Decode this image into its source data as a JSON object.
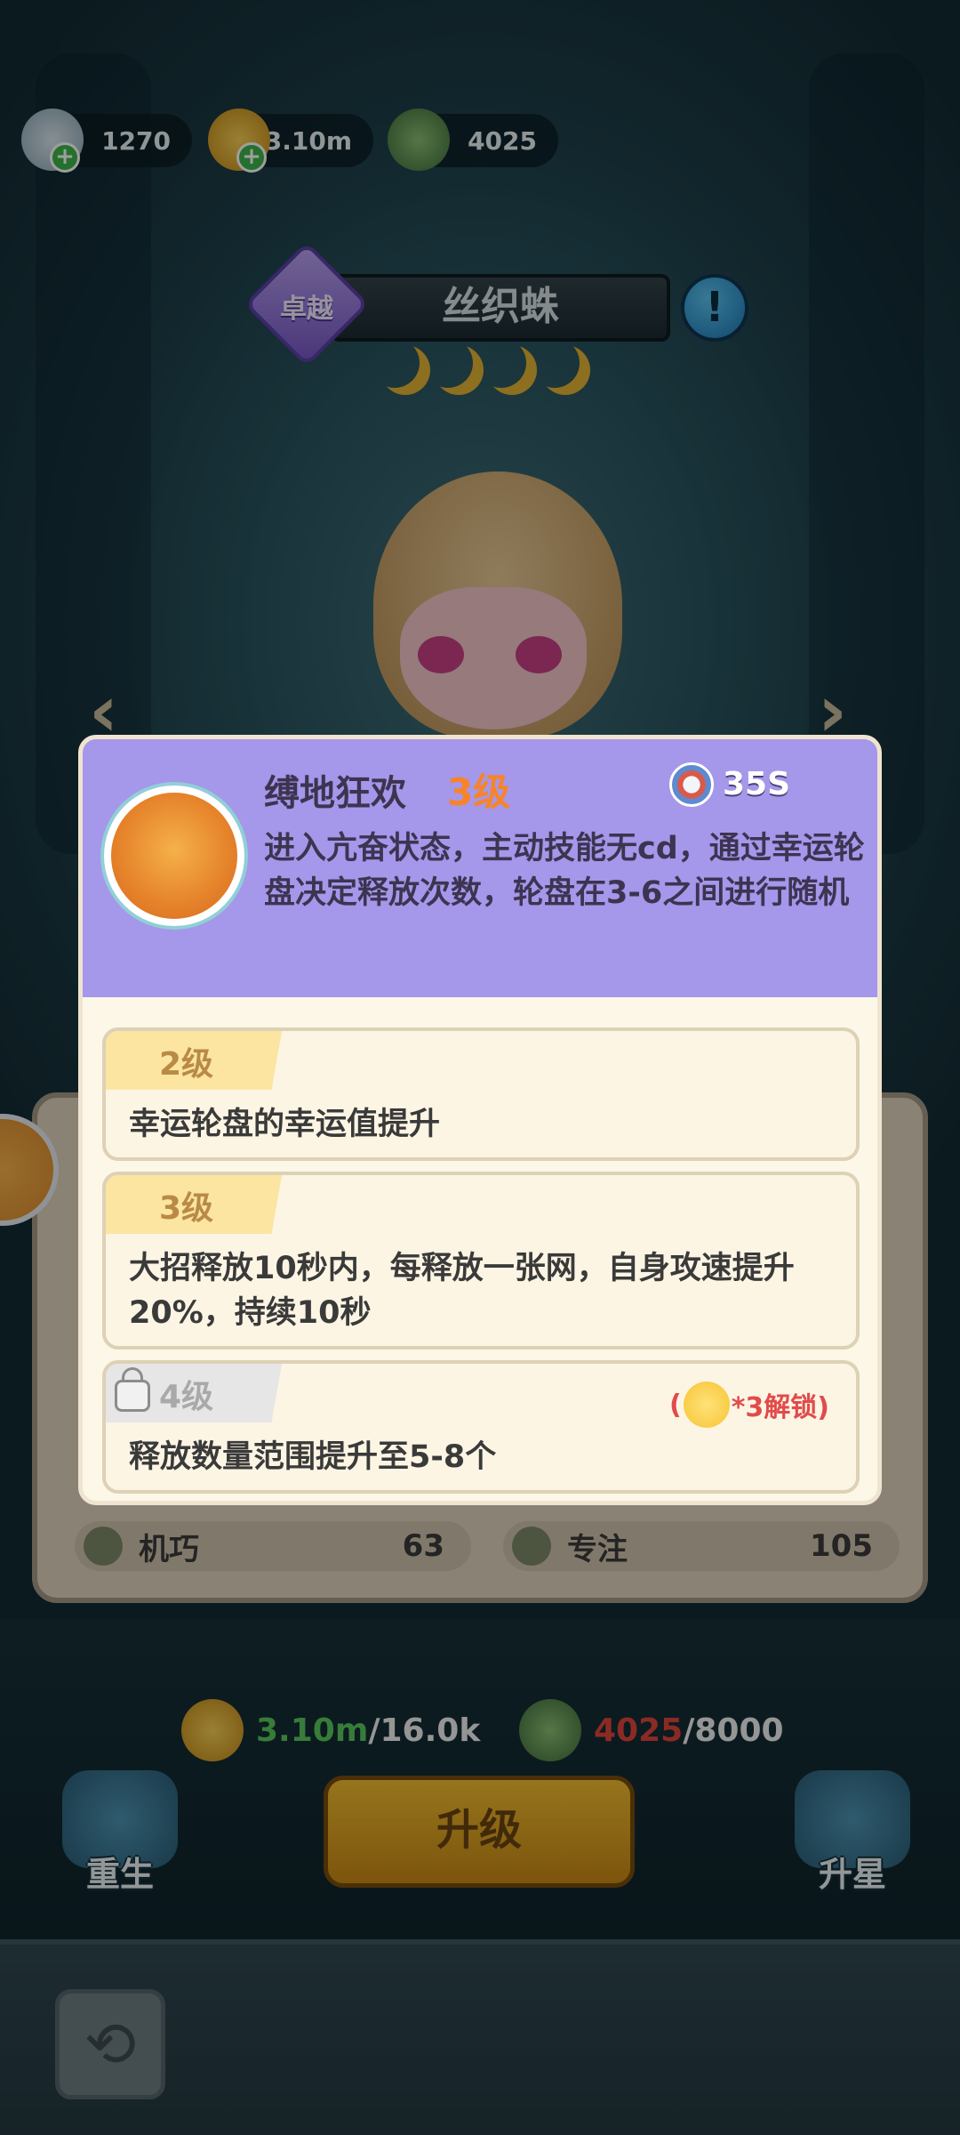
{
  "resources": [
    {
      "icon": "diamond-icon",
      "value": "1270",
      "has_plus": true
    },
    {
      "icon": "gold-coin-icon",
      "value": "3.10m",
      "has_plus": true
    },
    {
      "icon": "exp-icon",
      "value": "4025",
      "has_plus": false
    }
  ],
  "hero": {
    "grade": "卓越",
    "name": "丝织蛛",
    "info": "!",
    "moon_count": 4
  },
  "nav": {
    "prev": "‹",
    "next": "›"
  },
  "stats": [
    {
      "icon": "gear-icon",
      "label": "机巧",
      "value": "63"
    },
    {
      "icon": "eye-icon",
      "label": "专注",
      "value": "105"
    }
  ],
  "cost": {
    "gold_have": "3.10m",
    "gold_need": "/16.0k",
    "exp_have": "4025",
    "exp_need": "/8000"
  },
  "buttons": {
    "upgrade": "升级",
    "rebirth": "重生",
    "star_up": "升星",
    "back": "⟲"
  },
  "skill": {
    "name": "缚地狂欢",
    "level": "3级",
    "cooldown": "35S",
    "description": "进入亢奋状态，主动技能无cd，通过幸运轮盘决定释放次数，轮盘在3-6之间进行随机",
    "levels": [
      {
        "label": "2级",
        "text": "幸运轮盘的幸运值提升",
        "locked": false
      },
      {
        "label": "3级",
        "text": "大招释放10秒内，每释放一张网，自身攻速提升20%，持续10秒",
        "locked": false
      },
      {
        "label": "4级",
        "text": "释放数量范围提升至5-8个",
        "locked": true,
        "unlock_open": "(",
        "unlock_text": "*3解锁)"
      }
    ]
  },
  "colors": {
    "popup_header": "#a597ea",
    "level_accent": "#f7842a",
    "unlock_red": "#e14b4b",
    "upgrade_button": "#e0a522"
  }
}
